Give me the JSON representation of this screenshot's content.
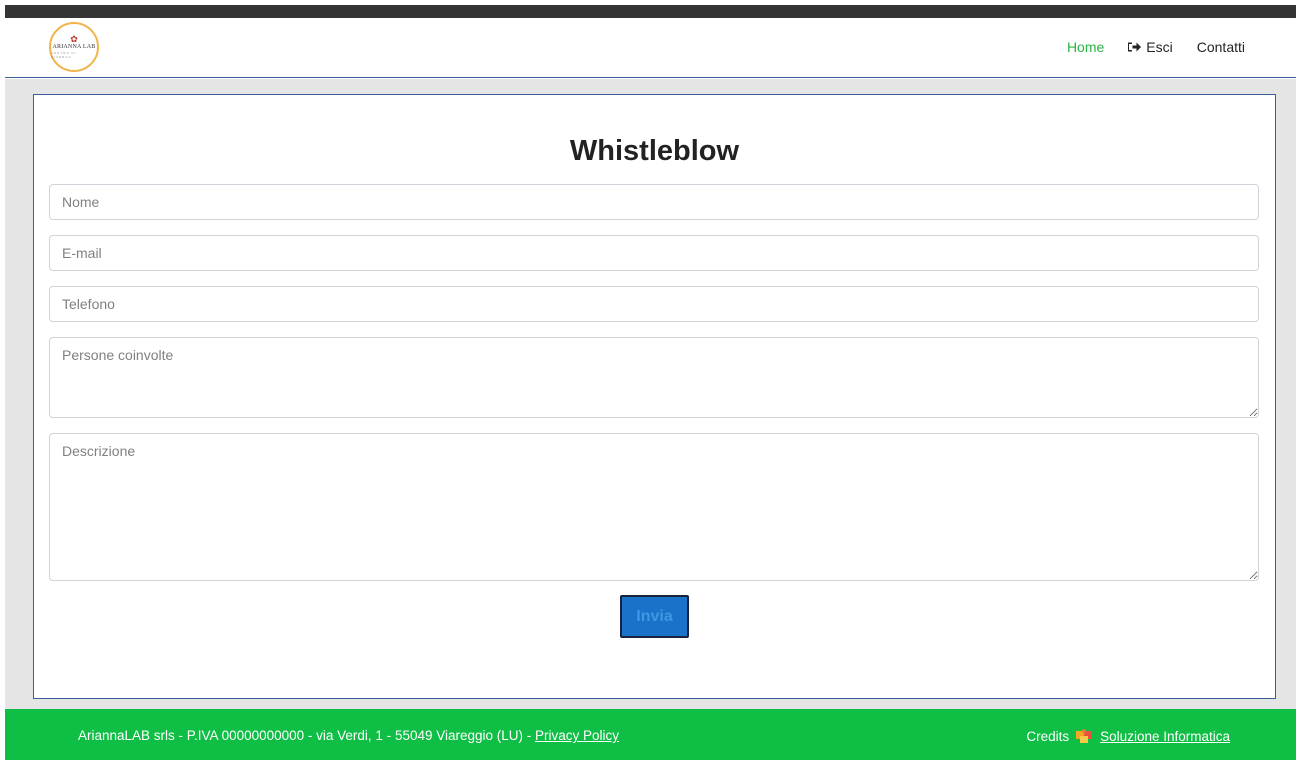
{
  "logo": {
    "name": "ARIANNA LAB",
    "tagline": "CENTRO DI RICERCA"
  },
  "nav": {
    "home": "Home",
    "exit": "Esci",
    "contacts": "Contatti",
    "exit_icon": "sign-out-icon"
  },
  "form": {
    "title": "Whistleblow",
    "fields": {
      "name": {
        "placeholder": "Nome",
        "value": ""
      },
      "email": {
        "placeholder": "E-mail",
        "value": ""
      },
      "phone": {
        "placeholder": "Telefono",
        "value": ""
      },
      "people": {
        "placeholder": "Persone coinvolte",
        "value": ""
      },
      "description": {
        "placeholder": "Descrizione",
        "value": ""
      }
    },
    "submit": "Invia"
  },
  "footer": {
    "company_info": "AriannaLAB srls - P.IVA 00000000000 - via Verdi, 1 - 55049 Viareggio (LU) - ",
    "privacy_link": "Privacy Policy",
    "credits_label": "Credits",
    "credits_link": "Soluzione Informatica",
    "credits_icon": "puzzle-icon"
  },
  "colors": {
    "topbar": "#343434",
    "accent_green": "#28b445",
    "footer_bg": "#0fbe45",
    "button_bg": "#1a73c8",
    "card_border": "#3b5f9a"
  }
}
